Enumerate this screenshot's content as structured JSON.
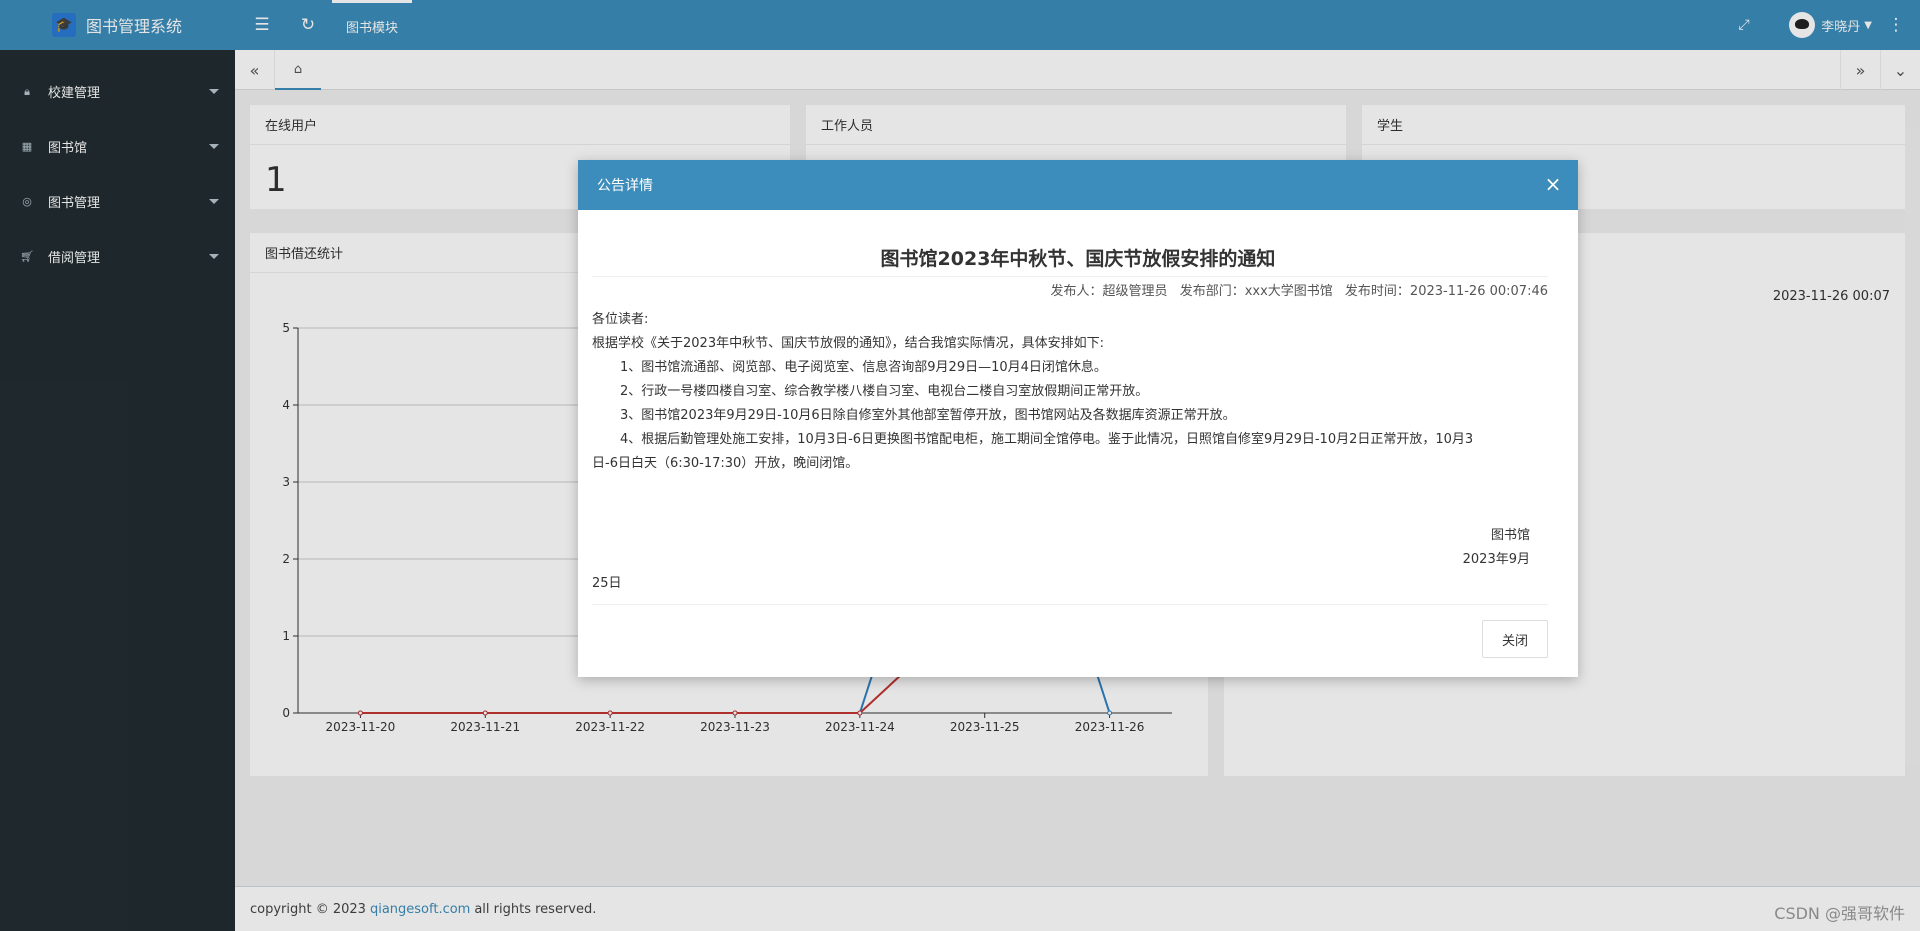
{
  "header": {
    "app_title": "图书管理系统",
    "module_tab": "图书模块",
    "user_name": "李晓丹"
  },
  "sidebar": {
    "items": [
      {
        "label": "校建管理",
        "icon": "lock-icon"
      },
      {
        "label": "图书馆",
        "icon": "table-icon"
      },
      {
        "label": "图书管理",
        "icon": "binoculars-icon"
      },
      {
        "label": "借阅管理",
        "icon": "cart-icon"
      }
    ]
  },
  "cards": {
    "online_users": {
      "title": "在线用户",
      "value": "1"
    },
    "staff": {
      "title": "工作人员"
    },
    "students": {
      "title": "学生"
    },
    "chart_card_title": "图书借还统计",
    "right_timestamp": "2023-11-26 00:07"
  },
  "chart_data": {
    "type": "line",
    "categories": [
      "2023-11-20",
      "2023-11-21",
      "2023-11-22",
      "2023-11-23",
      "2023-11-24",
      "2023-11-25",
      "2023-11-26"
    ],
    "ylim": [
      0,
      5
    ],
    "yticks": [
      "0",
      "1",
      "2",
      "3",
      "4",
      "5"
    ],
    "series": [
      {
        "color": "#2f7fc1",
        "values": [
          0,
          0,
          0,
          0,
          0,
          5,
          0
        ]
      },
      {
        "color": "#c23531",
        "values": [
          0,
          0,
          0,
          0,
          0,
          1.5,
          2
        ]
      }
    ]
  },
  "modal": {
    "title": "公告详情",
    "notice_title": "图书馆2023年中秋节、国庆节放假安排的通知",
    "meta_publisher": "发布人：超级管理员",
    "meta_department": "发布部门：xxx大学图书馆",
    "meta_time": "发布时间：2023-11-26 00:07:46",
    "greeting": "各位读者:",
    "intro": "根据学校《关于2023年中秋节、国庆节放假的通知》，结合我馆实际情况，具体安排如下:",
    "item1": "1、图书馆流通部、阅览部、电子阅览室、信息咨询部9月29日—10月4日闭馆休息。",
    "item2": "2、行政一号楼四楼自习室、综合教学楼八楼自习室、电视台二楼自习室放假期间正常开放。",
    "item3": "3、图书馆2023年9月29日-10月6日除自修室外其他部室暂停开放，图书馆网站及各数据库资源正常开放。",
    "item4_line1": "4、根据后勤管理处施工安排，10月3日-6日更换图书馆配电柜，施工期间全馆停电。鉴于此情况，日照馆自修室9月29日-10月2日正常开放，10月3",
    "item4_line2": "日-6日白天（6:30-17:30）开放，晚间闭馆。",
    "sign_org": "图书馆",
    "sign_date": "2023年9月",
    "sign_day": "25日",
    "close_button": "关闭"
  },
  "footer": {
    "copyright_prefix": "copyright © 2023",
    "link": "qiangesoft.com",
    "suffix": "all rights reserved.",
    "watermark": "CSDN @强哥软件"
  }
}
